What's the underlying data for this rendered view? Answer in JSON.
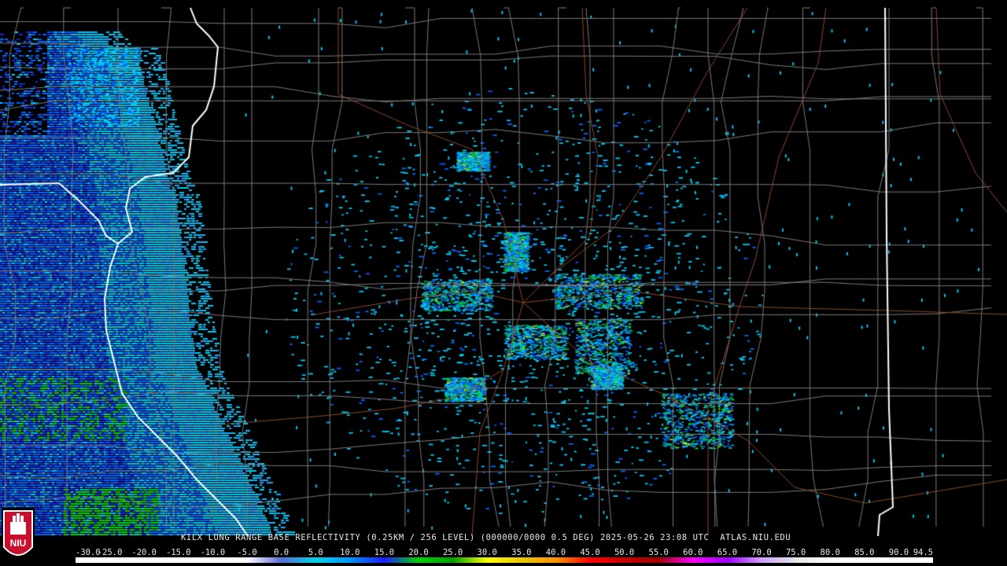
{
  "product_title": "KILX LONG RANGE BASE REFLECTIVITY (0.25KM / 256 LEVEL) (000000/0000 0.5 DEG) 2025-05-26 23:08 UTC  ATLAS.NIU.EDU",
  "logo_text": "NIU",
  "colorbar": {
    "ticks": [
      "-30.0",
      "-25.0",
      "-20.0",
      "-15.0",
      "-10.0",
      "-5.0",
      "0.0",
      "5.0",
      "10.0",
      "15.0",
      "20.0",
      "25.0",
      "30.0",
      "35.0",
      "40.0",
      "45.0",
      "50.0",
      "55.0",
      "60.0",
      "65.0",
      "70.0",
      "75.0",
      "80.0",
      "85.0",
      "90.0",
      "94.5"
    ],
    "colors": [
      "#ffffff",
      "#ffffff",
      "#ffffff",
      "#ffffff",
      "#ffffff",
      "#ffffff",
      "#5a6fd8",
      "#00d2e6",
      "#0096ff",
      "#1e1eff",
      "#00d200",
      "#00a000",
      "#ffff00",
      "#e6c800",
      "#ff9600",
      "#ff0000",
      "#c80000",
      "#a00000",
      "#ff00ff",
      "#a000ff",
      "#d2a0ff",
      "#e6e6e6",
      "#ffffff",
      "#ffffff",
      "#ffffff",
      "#ffffff"
    ]
  },
  "map_colors": {
    "county_lines": "#7a7a7a",
    "state_lines": "#ffffff",
    "roads": "#8b4a2b",
    "echo_light": "#00c8f0",
    "echo_mid": "#0064ff",
    "echo_dark": "#1428d2",
    "echo_green": "#00d200",
    "echo_yellow": "#dcdc00"
  }
}
